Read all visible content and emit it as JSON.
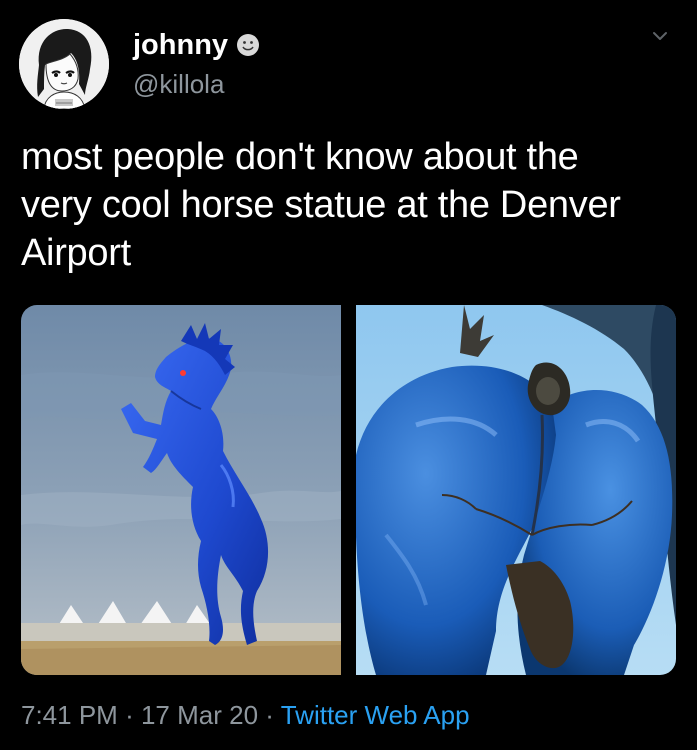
{
  "tweet": {
    "author": {
      "display_name": "johnny",
      "handle": "@killola",
      "name_emoji": "smiley-face-icon",
      "avatar": "anime-girl-avatar"
    },
    "text_lines": [
      "most people don't know about the",
      "very cool horse statue at the Denver",
      "Airport"
    ],
    "media": [
      {
        "name": "photo-blue-horse-statue-full",
        "description_icon": "blue-mustang-statue-image"
      },
      {
        "name": "photo-blue-horse-statue-closeup",
        "description_icon": "blue-mustang-closeup-image"
      }
    ],
    "meta": {
      "time": "7:41 PM",
      "separator": "·",
      "date": "17 Mar 20",
      "source": "Twitter Web App"
    },
    "menu_icon": "chevron-down-icon"
  },
  "colors": {
    "background": "#000000",
    "primary_text": "#ffffff",
    "secondary_text": "#8e969d",
    "link": "#2aa1f2"
  }
}
